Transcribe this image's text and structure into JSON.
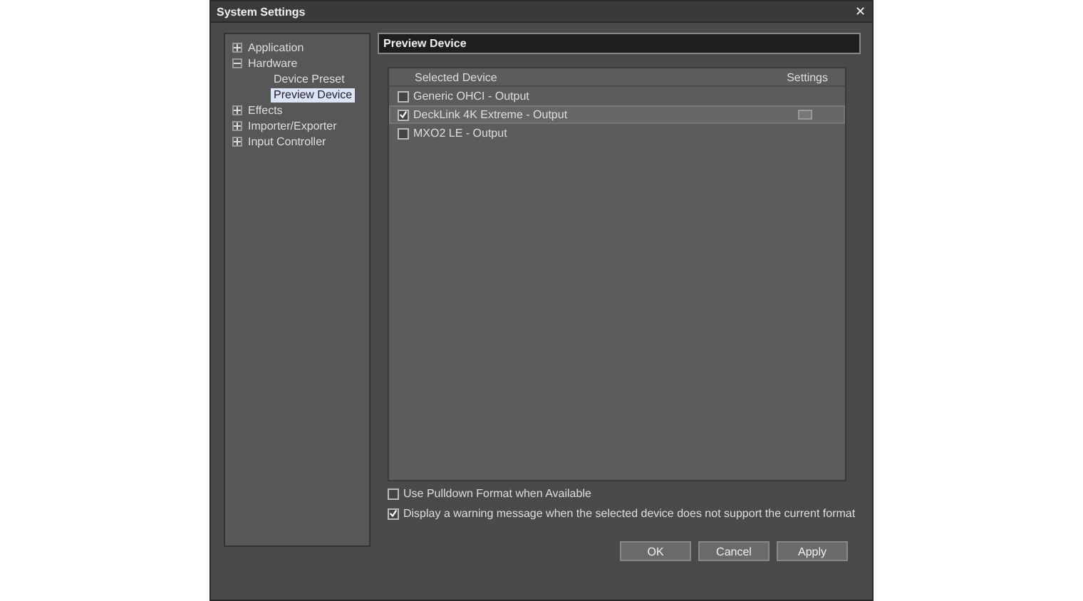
{
  "window": {
    "title": "System Settings",
    "close": "✕"
  },
  "tree": [
    {
      "label": "Application",
      "expanded": false,
      "selected": false
    },
    {
      "label": "Hardware",
      "expanded": true,
      "selected": false,
      "children": [
        {
          "label": "Device Preset",
          "selected": false
        },
        {
          "label": "Preview Device",
          "selected": true
        }
      ]
    },
    {
      "label": "Effects",
      "expanded": false,
      "selected": false
    },
    {
      "label": "Importer/Exporter",
      "expanded": false,
      "selected": false
    },
    {
      "label": "Input Controller",
      "expanded": false,
      "selected": false
    }
  ],
  "page_title": "Preview Device",
  "table": {
    "columns": [
      "Selected Device",
      "Settings"
    ],
    "rows": [
      {
        "name": "Generic OHCI - Output",
        "checked": false,
        "selected": false
      },
      {
        "name": "DeckLink 4K Extreme - Output",
        "checked": true,
        "selected": true
      },
      {
        "name": "MXO2 LE - Output",
        "checked": false,
        "selected": false
      }
    ]
  },
  "options": [
    {
      "label": "Use Pulldown Format when Available",
      "checked": false
    },
    {
      "label": "Display a warning message when the selected device does not support the current format",
      "checked": true
    }
  ],
  "buttons": [
    {
      "label": "OK"
    },
    {
      "label": "Cancel"
    },
    {
      "label": "Apply"
    }
  ]
}
